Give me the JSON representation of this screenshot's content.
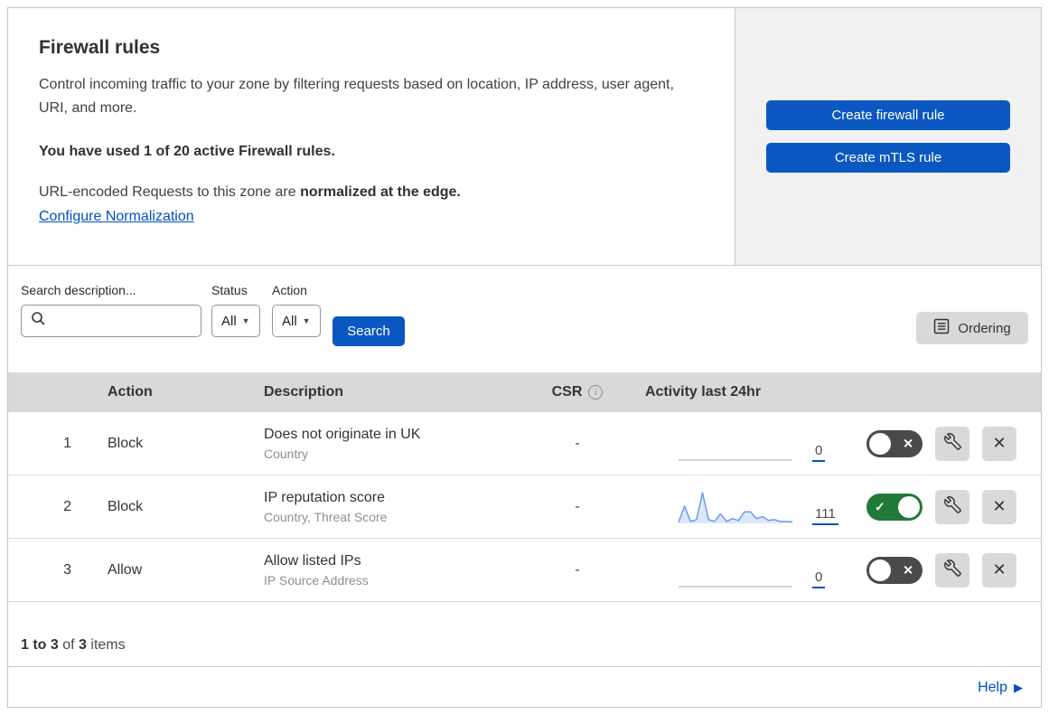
{
  "header": {
    "title": "Firewall rules",
    "description": "Control incoming traffic to your zone by filtering requests based on location, IP address, user agent, URI, and more.",
    "usage": "You have used 1 of 20 active Firewall rules.",
    "normalization_prefix": "URL-encoded Requests to this zone are ",
    "normalization_bold": "normalized at the edge.",
    "normalization_link": "Configure Normalization",
    "create_firewall_rule_label": "Create firewall rule",
    "create_mtls_rule_label": "Create mTLS rule"
  },
  "filters": {
    "search_label": "Search description...",
    "status_label": "Status",
    "status_value": "All",
    "action_label": "Action",
    "action_value": "All",
    "search_button_label": "Search",
    "ordering_button_label": "Ordering"
  },
  "icons": {
    "dropdown_caret": "▼",
    "toggle_off_mark": "✕",
    "toggle_on_mark": "✓",
    "close_mark": "✕",
    "info_mark": "i",
    "help_arrow": "▶"
  },
  "table": {
    "columns": {
      "action": "Action",
      "description": "Description",
      "csr": "CSR",
      "activity": "Activity last 24hr"
    },
    "rows": [
      {
        "num": "1",
        "action": "Block",
        "description": "Does not originate in UK",
        "fields": "Country",
        "csr": "-",
        "activity_count": "0",
        "enabled": false,
        "sparkline": []
      },
      {
        "num": "2",
        "action": "Block",
        "description": "IP reputation score",
        "fields": "Country, Threat Score",
        "csr": "-",
        "activity_count": "111",
        "enabled": true,
        "sparkline": [
          0.5,
          9,
          1,
          2,
          16,
          2,
          1,
          5,
          1,
          2.5,
          1.5,
          6,
          6,
          2.5,
          3.5,
          1.5,
          2,
          1,
          1,
          0.8
        ]
      },
      {
        "num": "3",
        "action": "Allow",
        "description": "Allow listed IPs",
        "fields": "IP Source Address",
        "csr": "-",
        "activity_count": "0",
        "enabled": false,
        "sparkline": []
      }
    ]
  },
  "footer": {
    "range": "1 to 3",
    "of_text": "of",
    "total": "3",
    "items_text": "items",
    "help_label": "Help"
  },
  "colors": {
    "primary_blue": "#0b57c2",
    "link_blue": "#0051c3",
    "toggle_green": "#217a37",
    "toggle_gray": "#4a4a4a",
    "sparkline_stroke": "#6b9bf2",
    "sparkline_fill": "#dce8fa"
  }
}
